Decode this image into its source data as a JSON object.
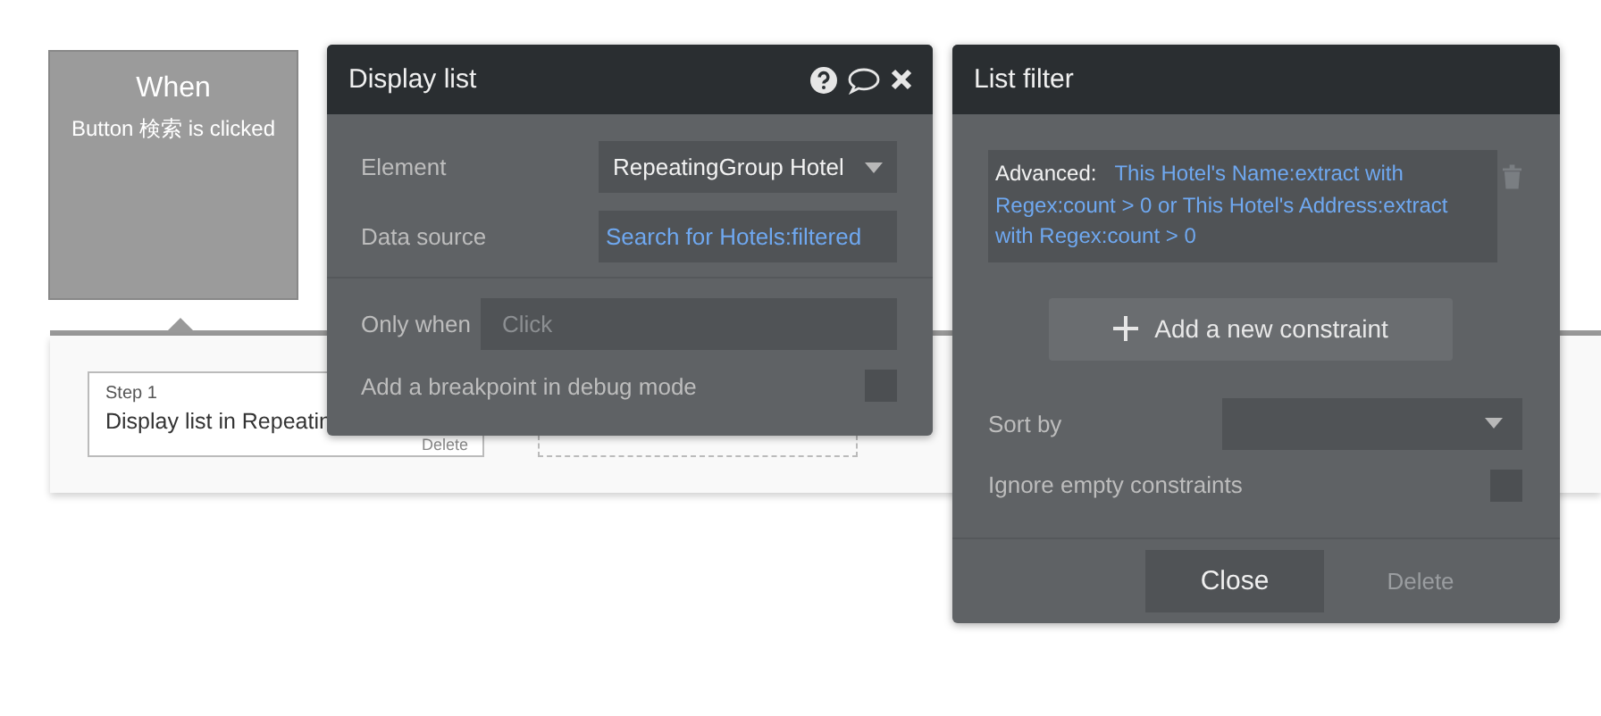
{
  "event": {
    "title": "When",
    "description": "Button 検索 is clicked"
  },
  "step": {
    "label": "Step 1",
    "title": "Display list in Repeatin",
    "delete": "Delete"
  },
  "display_list": {
    "title": "Display list",
    "fields": [
      {
        "kind": "dropdown",
        "label": "Element",
        "value": "RepeatingGroup Hotel"
      },
      {
        "kind": "expression",
        "label": "Data source",
        "value": "Search for Hotels:filtered"
      }
    ],
    "only_when": {
      "label": "Only when",
      "placeholder": "Click"
    },
    "breakpoint": {
      "label": "Add a breakpoint in debug mode",
      "checked": false
    }
  },
  "list_filter": {
    "title": "List filter",
    "constraints": [
      {
        "label": "Advanced:",
        "value": "This Hotel's Name:extract with Regex:count > 0 or This Hotel's Address:extract with Regex:count > 0"
      }
    ],
    "add_button": "Add a new constraint",
    "sort_by": {
      "label": "Sort by"
    },
    "ignore_empty": {
      "label": "Ignore empty constraints",
      "checked": false
    },
    "buttons": [
      {
        "label": "Close",
        "disabled": false
      },
      {
        "label": "Delete",
        "disabled": true
      }
    ]
  }
}
